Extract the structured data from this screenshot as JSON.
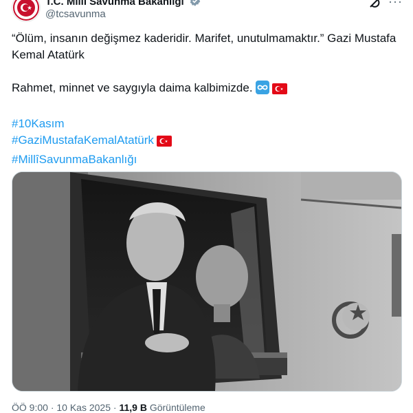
{
  "account": {
    "name": "T.C. Millî Savunma Bakanlığı",
    "handle": "@tcsavunma"
  },
  "tweet": {
    "line1": "“Ölüm, insanın değişmez kaderidir. Marifet, unutulmamaktır.” Gazi Mustafa Kemal Atatürk",
    "line2": "Rahmet, minnet ve saygıyla daima kalbimizde.",
    "hashtags": [
      "#10Kasım",
      "#GaziMustafaKemalAtatürk",
      "#MillîSavunmaBakanlığı"
    ]
  },
  "media": {
    "description_icon": "photo-icon"
  },
  "meta": {
    "time": "ÖÖ 9:00",
    "separator": "·",
    "date": "10 Kas 2025",
    "views_count": "11,9 B",
    "views_label": "Görüntüleme"
  },
  "icons": {
    "verified": "verified-badge-icon",
    "grok": "grok-icon",
    "more": "more-icon",
    "infinity": "infinity-emoji-icon",
    "flag": "turkey-flag-icon"
  },
  "colors": {
    "accent": "#1d9bf0",
    "muted": "#536471",
    "text": "#0f1419",
    "flag_red": "#e30a17"
  }
}
